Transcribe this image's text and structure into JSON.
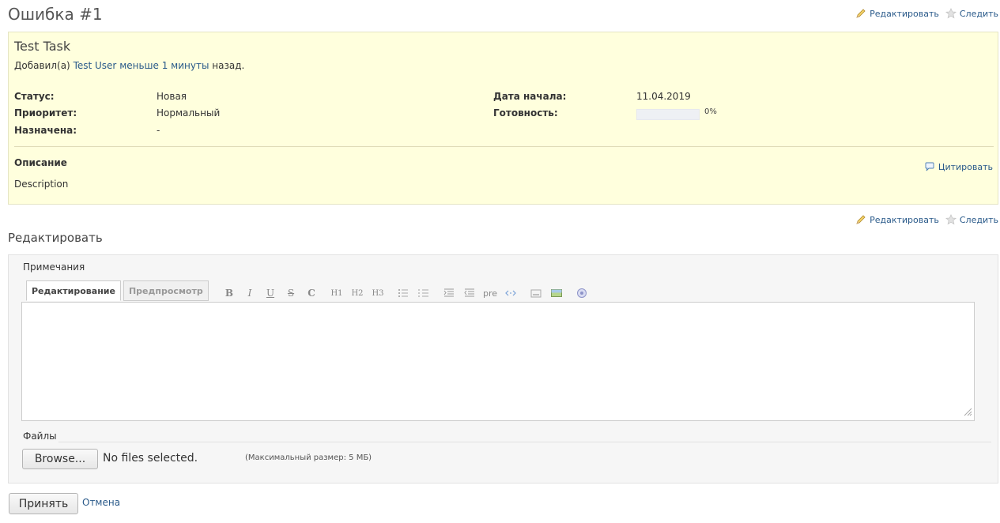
{
  "page": {
    "title": "Ошибка #1"
  },
  "contextual": {
    "edit_label": "Редактировать",
    "watch_label": "Следить"
  },
  "issue": {
    "subject": "Test Task",
    "author": {
      "prefix": "Добавил(а)",
      "user": "Test User",
      "time_ago": "меньше 1 минуты",
      "suffix": "назад."
    },
    "attributes": {
      "status": {
        "label": "Статус:",
        "value": "Новая"
      },
      "priority": {
        "label": "Приоритет:",
        "value": "Нормальный"
      },
      "assigned": {
        "label": "Назначена:",
        "value": "-"
      },
      "start_date": {
        "label": "Дата начала:",
        "value": "11.04.2019"
      },
      "done_ratio": {
        "label": "Готовность:",
        "value": "0%",
        "fraction": 0
      }
    },
    "description": {
      "title": "Описание",
      "text": "Description",
      "quote_label": "Цитировать"
    }
  },
  "edit_section": {
    "title": "Редактировать",
    "notes_legend": "Примечания",
    "tabs": [
      {
        "label": "Редактирование",
        "active": true
      },
      {
        "label": "Предпросмотр",
        "active": false
      }
    ],
    "toolbar": [
      {
        "name": "bold",
        "glyph": "B"
      },
      {
        "name": "italic",
        "glyph": "I"
      },
      {
        "name": "underline",
        "glyph": "U"
      },
      {
        "name": "strikethrough",
        "glyph": "S"
      },
      {
        "name": "code",
        "glyph": "C"
      },
      {
        "name": "h1",
        "glyph": "H1"
      },
      {
        "name": "h2",
        "glyph": "H2"
      },
      {
        "name": "h3",
        "glyph": "H3"
      },
      {
        "name": "unordered-list",
        "glyph": ""
      },
      {
        "name": "ordered-list",
        "glyph": ""
      },
      {
        "name": "blockquote",
        "glyph": ""
      },
      {
        "name": "unblockquote",
        "glyph": ""
      },
      {
        "name": "pre",
        "glyph": "pre"
      },
      {
        "name": "link",
        "glyph": ""
      },
      {
        "name": "wiki-page",
        "glyph": ""
      },
      {
        "name": "image",
        "glyph": ""
      },
      {
        "name": "help",
        "glyph": ""
      }
    ],
    "files_legend": "Файлы",
    "browse_label": "Browse...",
    "no_files_text": "No files selected.",
    "max_size_text": "(Максимальный размер: 5 МБ)"
  },
  "form": {
    "submit_label": "Принять",
    "cancel_label": "Отмена"
  }
}
